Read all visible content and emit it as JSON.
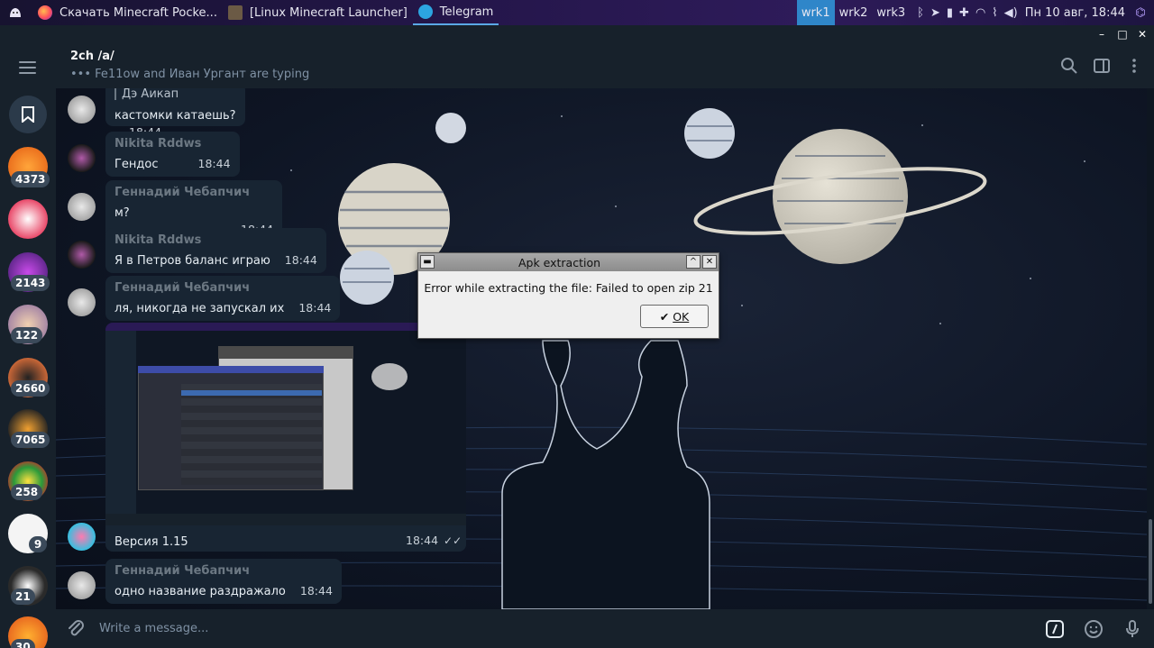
{
  "taskbar": {
    "tasks": [
      {
        "label": "Скачать Minecraft Pocke..."
      },
      {
        "label": "[Linux Minecraft Launcher]"
      },
      {
        "label": "Telegram"
      }
    ],
    "workspaces": [
      "wrk1",
      "wrk2",
      "wrk3"
    ],
    "clock": "Пн 10 авг, 18:44"
  },
  "header": {
    "title": "2ch /a/",
    "typing": "Fe11ow and Иван Ургант are typing"
  },
  "rail": {
    "badges": [
      "4373",
      "2143",
      "122",
      "2660",
      "7065",
      "258",
      "9",
      "21",
      "30"
    ]
  },
  "messages": [
    {
      "name": "",
      "quote": "Дэ Аикап",
      "text": "кастомки катаешь?",
      "time": "18:44"
    },
    {
      "name": "Nikita Rddws",
      "text": "Гендос",
      "time": "18:44"
    },
    {
      "name": "Геннадий Чебапчич",
      "text": "м?",
      "time": "18:44"
    },
    {
      "name": "Nikita Rddws",
      "text": "Я в Петров баланс играю",
      "time": "18:44"
    },
    {
      "name": "Геннадий Чебапчич",
      "text": "ля, никогда не запускал их",
      "time": "18:44"
    },
    {
      "name": "",
      "text": "Версия 1.15",
      "time": "18:44"
    },
    {
      "name": "Геннадий Чебапчич",
      "text": "одно название раздражало",
      "time": "18:44"
    }
  ],
  "composer": {
    "placeholder": "Write a message..."
  },
  "dialog": {
    "title": "Apk extraction",
    "message": "Error while extracting the file: Failed to open zip 21",
    "ok_label": "OK"
  },
  "colors": {
    "sidebar": "#17212b",
    "bubble": "#182533",
    "accent": "#2f86c9",
    "taskbar": "#24164a"
  }
}
